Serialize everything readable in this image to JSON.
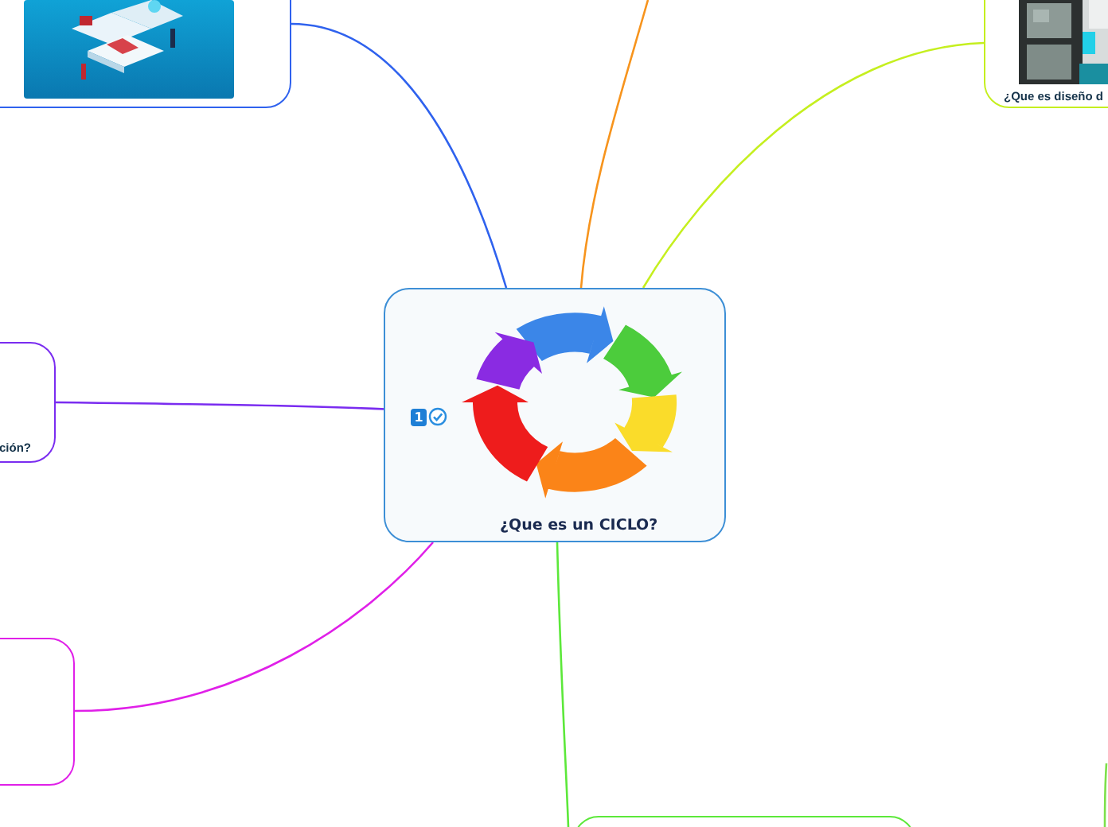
{
  "central": {
    "title": "¿Que es un CICLO?",
    "badge": "1",
    "color": "#3d8fd6"
  },
  "branches": [
    {
      "kind": "picture",
      "color": "#2f62ee"
    },
    {
      "kind": "line",
      "color": "#f7941d"
    },
    {
      "kind": "picture",
      "color": "#c5ef1f",
      "title": "¿Que es diseño d"
    },
    {
      "kind": "text",
      "color": "#7a2cf0",
      "title": "ción?"
    },
    {
      "kind": "empty",
      "color": "#e020e8"
    },
    {
      "kind": "empty",
      "color": "#5ce83a"
    },
    {
      "kind": "line",
      "color": "#7de04a"
    }
  ]
}
